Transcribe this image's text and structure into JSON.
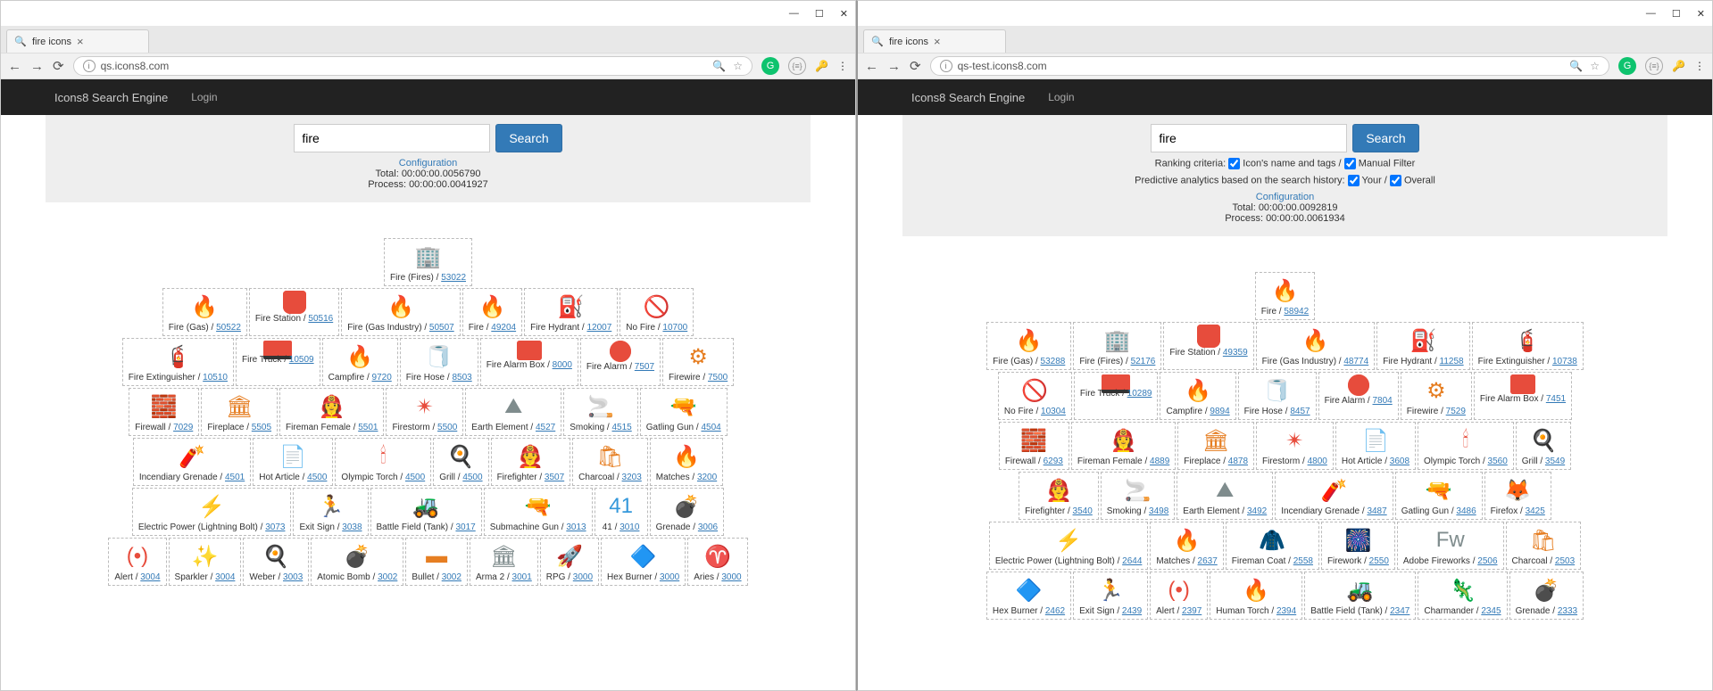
{
  "windows": [
    {
      "tab_title": "fire icons",
      "url_label": "qs.icons8.com",
      "brand": "Icons8 Search Engine",
      "login": "Login",
      "search_value": "fire",
      "search_button": "Search",
      "show_criteria": false,
      "config_label": "Configuration",
      "total_line": "Total: 00:00:00.0056790",
      "process_line": "Process: 00:00:00.0041927",
      "rows": [
        [
          {
            "label": "Fire (Fires)",
            "score": "53022",
            "emoji": "🏢",
            "cls": "fire-orange"
          }
        ],
        [
          {
            "label": "Fire (Gas)",
            "score": "50522",
            "emoji": "🔥",
            "cls": "fire-blue"
          },
          {
            "label": "Fire Station",
            "score": "50516",
            "emoji": "",
            "cls": "shield-red"
          },
          {
            "label": "Fire (Gas Industry)",
            "score": "50507",
            "emoji": "🔥",
            "cls": "fire-blue"
          },
          {
            "label": "Fire",
            "score": "49204",
            "emoji": "🔥",
            "cls": "fire-orange"
          },
          {
            "label": "Fire Hydrant",
            "score": "12007",
            "emoji": "⛽",
            "cls": "hydrant"
          },
          {
            "label": "No Fire",
            "score": "10700",
            "emoji": "🚫",
            "cls": "generic"
          }
        ],
        [
          {
            "label": "Fire Extinguisher",
            "score": "10510",
            "emoji": "🧯",
            "cls": "fire-orange"
          },
          {
            "label": "Fire Truck",
            "score": "10509",
            "emoji": "",
            "cls": "truck-red"
          },
          {
            "label": "Campfire",
            "score": "9720",
            "emoji": "🔥",
            "cls": "campfire"
          },
          {
            "label": "Fire Hose",
            "score": "8503",
            "emoji": "🧻",
            "cls": "generic"
          },
          {
            "label": "Fire Alarm Box",
            "score": "8000",
            "emoji": "",
            "cls": "tv-red"
          },
          {
            "label": "Fire Alarm",
            "score": "7507",
            "emoji": "",
            "cls": "circle-red"
          },
          {
            "label": "Firewire",
            "score": "7500",
            "emoji": "⚙",
            "cls": "campfire"
          }
        ],
        [
          {
            "label": "Firewall",
            "score": "7029",
            "emoji": "🧱",
            "cls": "generic"
          },
          {
            "label": "Fireplace",
            "score": "5505",
            "emoji": "🏛",
            "cls": "campfire"
          },
          {
            "label": "Fireman Female",
            "score": "5501",
            "emoji": "👩‍🚒",
            "cls": ""
          },
          {
            "label": "Firestorm",
            "score": "5500",
            "emoji": "✴",
            "cls": "fire-orange"
          },
          {
            "label": "Earth Element",
            "score": "4527",
            "emoji": "⛰",
            "cls": "generic"
          },
          {
            "label": "Smoking",
            "score": "4515",
            "emoji": "🚬",
            "cls": "generic"
          },
          {
            "label": "Gatling Gun",
            "score": "4504",
            "emoji": "🔫",
            "cls": "generic"
          }
        ],
        [
          {
            "label": "Incendiary Grenade",
            "score": "4501",
            "emoji": "🧨",
            "cls": "fire-orange"
          },
          {
            "label": "Hot Article",
            "score": "4500",
            "emoji": "📄",
            "cls": "page-fire"
          },
          {
            "label": "Olympic Torch",
            "score": "4500",
            "emoji": "🕯",
            "cls": "fire-orange"
          },
          {
            "label": "Grill",
            "score": "4500",
            "emoji": "🍳",
            "cls": "generic"
          },
          {
            "label": "Firefighter",
            "score": "3507",
            "emoji": "👨‍🚒",
            "cls": ""
          },
          {
            "label": "Charcoal",
            "score": "3203",
            "emoji": "🛍",
            "cls": "campfire"
          },
          {
            "label": "Matches",
            "score": "3200",
            "emoji": "🔥",
            "cls": "fire-orange"
          }
        ],
        [
          {
            "label": "Electric Power (Lightning Bolt)",
            "score": "3073",
            "emoji": "⚡",
            "cls": ""
          },
          {
            "label": "Exit Sign",
            "score": "3038",
            "emoji": "🏃",
            "cls": "generic"
          },
          {
            "label": "Battle Field (Tank)",
            "score": "3017",
            "emoji": "🚜",
            "cls": "generic"
          },
          {
            "label": "Submachine Gun",
            "score": "3013",
            "emoji": "🔫",
            "cls": "generic"
          },
          {
            "label": "41",
            "score": "3010",
            "emoji": "41",
            "cls": "fire-blue"
          },
          {
            "label": "Grenade",
            "score": "3006",
            "emoji": "💣",
            "cls": "generic"
          }
        ],
        [
          {
            "label": "Alert",
            "score": "3004",
            "emoji": "(•)",
            "cls": "fire-orange"
          },
          {
            "label": "Sparkler",
            "score": "3004",
            "emoji": "✨",
            "cls": ""
          },
          {
            "label": "Weber",
            "score": "3003",
            "emoji": "🍳",
            "cls": "generic"
          },
          {
            "label": "Atomic Bomb",
            "score": "3002",
            "emoji": "💣",
            "cls": "generic"
          },
          {
            "label": "Bullet",
            "score": "3002",
            "emoji": "▬",
            "cls": "campfire"
          },
          {
            "label": "Arma 2",
            "score": "3001",
            "emoji": "🏛",
            "cls": "generic"
          },
          {
            "label": "RPG",
            "score": "3000",
            "emoji": "🚀",
            "cls": "generic"
          },
          {
            "label": "Hex Burner",
            "score": "3000",
            "emoji": "🔷",
            "cls": "fire-blue"
          },
          {
            "label": "Aries",
            "score": "3000",
            "emoji": "♈",
            "cls": "campfire"
          }
        ]
      ]
    },
    {
      "tab_title": "fire icons",
      "url_label": "qs-test.icons8.com",
      "brand": "Icons8 Search Engine",
      "login": "Login",
      "search_value": "fire",
      "search_button": "Search",
      "show_criteria": true,
      "criteria_line1_a": "Ranking criteria:",
      "criteria_line1_b": "Icon's name and tags /",
      "criteria_line1_c": "Manual Filter",
      "criteria_line2_a": "Predictive analytics based on the search history:",
      "criteria_line2_b": "Your /",
      "criteria_line2_c": "Overall",
      "config_label": "Configuration",
      "total_line": "Total: 00:00:00.0092819",
      "process_line": "Process: 00:00:00.0061934",
      "rows": [
        [
          {
            "label": "Fire",
            "score": "58942",
            "emoji": "🔥",
            "cls": "fire-orange"
          }
        ],
        [
          {
            "label": "Fire (Gas)",
            "score": "53288",
            "emoji": "🔥",
            "cls": "fire-blue"
          },
          {
            "label": "Fire (Fires)",
            "score": "52176",
            "emoji": "🏢",
            "cls": "fire-orange"
          },
          {
            "label": "Fire Station",
            "score": "49359",
            "emoji": "",
            "cls": "shield-red"
          },
          {
            "label": "Fire (Gas Industry)",
            "score": "48774",
            "emoji": "🔥",
            "cls": "fire-blue"
          },
          {
            "label": "Fire Hydrant",
            "score": "11258",
            "emoji": "⛽",
            "cls": "hydrant"
          },
          {
            "label": "Fire Extinguisher",
            "score": "10738",
            "emoji": "🧯",
            "cls": "fire-orange"
          }
        ],
        [
          {
            "label": "No Fire",
            "score": "10304",
            "emoji": "🚫",
            "cls": "generic"
          },
          {
            "label": "Fire Truck",
            "score": "10289",
            "emoji": "",
            "cls": "truck-red"
          },
          {
            "label": "Campfire",
            "score": "9894",
            "emoji": "🔥",
            "cls": "campfire"
          },
          {
            "label": "Fire Hose",
            "score": "8457",
            "emoji": "🧻",
            "cls": "generic"
          },
          {
            "label": "Fire Alarm",
            "score": "7804",
            "emoji": "",
            "cls": "circle-red"
          },
          {
            "label": "Firewire",
            "score": "7529",
            "emoji": "⚙",
            "cls": "campfire"
          },
          {
            "label": "Fire Alarm Box",
            "score": "7451",
            "emoji": "",
            "cls": "tv-red"
          }
        ],
        [
          {
            "label": "Firewall",
            "score": "6293",
            "emoji": "🧱",
            "cls": "generic"
          },
          {
            "label": "Fireman Female",
            "score": "4889",
            "emoji": "👩‍🚒",
            "cls": ""
          },
          {
            "label": "Fireplace",
            "score": "4878",
            "emoji": "🏛",
            "cls": "campfire"
          },
          {
            "label": "Firestorm",
            "score": "4800",
            "emoji": "✴",
            "cls": "fire-orange"
          },
          {
            "label": "Hot Article",
            "score": "3608",
            "emoji": "📄",
            "cls": "page-fire"
          },
          {
            "label": "Olympic Torch",
            "score": "3560",
            "emoji": "🕯",
            "cls": "fire-orange"
          },
          {
            "label": "Grill",
            "score": "3549",
            "emoji": "🍳",
            "cls": "generic"
          }
        ],
        [
          {
            "label": "Firefighter",
            "score": "3540",
            "emoji": "👨‍🚒",
            "cls": ""
          },
          {
            "label": "Smoking",
            "score": "3498",
            "emoji": "🚬",
            "cls": "generic"
          },
          {
            "label": "Earth Element",
            "score": "3492",
            "emoji": "⛰",
            "cls": "generic"
          },
          {
            "label": "Incendiary Grenade",
            "score": "3487",
            "emoji": "🧨",
            "cls": "fire-orange"
          },
          {
            "label": "Gatling Gun",
            "score": "3486",
            "emoji": "🔫",
            "cls": "generic"
          },
          {
            "label": "Firefox",
            "score": "3425",
            "emoji": "🦊",
            "cls": ""
          }
        ],
        [
          {
            "label": "Electric Power (Lightning Bolt)",
            "score": "2644",
            "emoji": "⚡",
            "cls": ""
          },
          {
            "label": "Matches",
            "score": "2637",
            "emoji": "🔥",
            "cls": "fire-orange"
          },
          {
            "label": "Fireman Coat",
            "score": "2558",
            "emoji": "🧥",
            "cls": "fire-orange"
          },
          {
            "label": "Firework",
            "score": "2550",
            "emoji": "🎆",
            "cls": ""
          },
          {
            "label": "Adobe Fireworks",
            "score": "2506",
            "emoji": "Fw",
            "cls": "generic"
          },
          {
            "label": "Charcoal",
            "score": "2503",
            "emoji": "🛍",
            "cls": "campfire"
          }
        ],
        [
          {
            "label": "Hex Burner",
            "score": "2462",
            "emoji": "🔷",
            "cls": "fire-blue"
          },
          {
            "label": "Exit Sign",
            "score": "2439",
            "emoji": "🏃",
            "cls": "generic"
          },
          {
            "label": "Alert",
            "score": "2397",
            "emoji": "(•)",
            "cls": "fire-orange"
          },
          {
            "label": "Human Torch",
            "score": "2394",
            "emoji": "🔥",
            "cls": "fire-orange"
          },
          {
            "label": "Battle Field (Tank)",
            "score": "2347",
            "emoji": "🚜",
            "cls": "generic"
          },
          {
            "label": "Charmander",
            "score": "2345",
            "emoji": "🦎",
            "cls": "campfire"
          },
          {
            "label": "Grenade",
            "score": "2333",
            "emoji": "💣",
            "cls": "generic"
          }
        ]
      ]
    }
  ]
}
